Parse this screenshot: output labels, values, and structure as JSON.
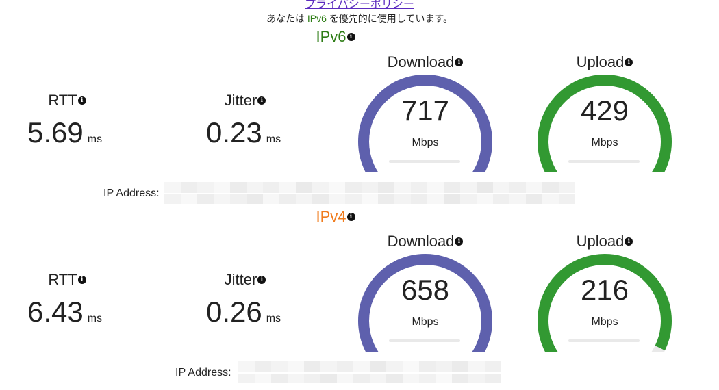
{
  "privacy_link": "プライバシーポリシー",
  "preference": {
    "before": "あなたは ",
    "highlight": "IPv6",
    "after": " を優先的に使用しています。"
  },
  "colors": {
    "ipv6": "#2e7d16",
    "ipv4": "#f07c1e",
    "download": "#5e60ad",
    "upload": "#329932",
    "track": "#e9e9e9"
  },
  "ipv6": {
    "title": "IPv6",
    "rtt": {
      "label": "RTT",
      "value": "5.69",
      "unit": "ms"
    },
    "jitter": {
      "label": "Jitter",
      "value": "0.23",
      "unit": "ms"
    },
    "download": {
      "label": "Download",
      "value": "717",
      "unit": "Mbps",
      "fill": 1.0
    },
    "upload": {
      "label": "Upload",
      "value": "429",
      "unit": "Mbps",
      "fill": 0.97
    },
    "ip_label": "IP Address:"
  },
  "ipv4": {
    "title": "IPv4",
    "rtt": {
      "label": "RTT",
      "value": "6.43",
      "unit": "ms"
    },
    "jitter": {
      "label": "Jitter",
      "value": "0.26",
      "unit": "ms"
    },
    "download": {
      "label": "Download",
      "value": "658",
      "unit": "Mbps",
      "fill": 1.0
    },
    "upload": {
      "label": "Upload",
      "value": "216",
      "unit": "Mbps",
      "fill": 0.93
    },
    "ip_label": "IP Address:"
  }
}
